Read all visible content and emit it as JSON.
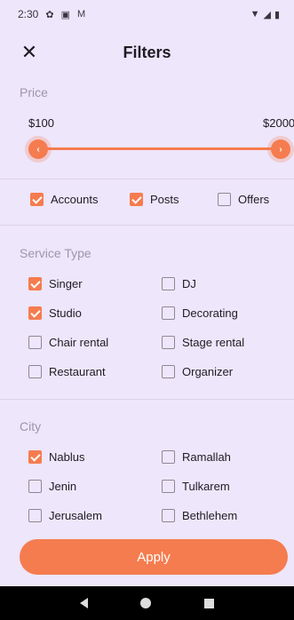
{
  "status_bar": {
    "time": "2:30",
    "icons": [
      "gear-icon",
      "notification-icon",
      "gmail-icon"
    ],
    "right_icons": [
      "wifi-icon",
      "signal-icon",
      "battery-icon"
    ]
  },
  "header": {
    "title": "Filters",
    "close_icon": "close-icon"
  },
  "price": {
    "label": "Price",
    "min_label": "$100",
    "max_label": "$2000",
    "range_min_fraction": 0.0,
    "range_max_fraction": 1.0
  },
  "types": [
    {
      "label": "Accounts",
      "checked": true
    },
    {
      "label": "Posts",
      "checked": true
    },
    {
      "label": "Offers",
      "checked": false
    }
  ],
  "service_type": {
    "label": "Service Type",
    "options": [
      {
        "label": "Singer",
        "checked": true
      },
      {
        "label": "DJ",
        "checked": false
      },
      {
        "label": "Studio",
        "checked": true
      },
      {
        "label": "Decorating",
        "checked": false
      },
      {
        "label": "Chair rental",
        "checked": false
      },
      {
        "label": "Stage rental",
        "checked": false
      },
      {
        "label": "Restaurant",
        "checked": false
      },
      {
        "label": "Organizer",
        "checked": false
      }
    ]
  },
  "city": {
    "label": "City",
    "options": [
      {
        "label": "Nablus",
        "checked": true
      },
      {
        "label": "Ramallah",
        "checked": false
      },
      {
        "label": "Jenin",
        "checked": false
      },
      {
        "label": "Tulkarem",
        "checked": false
      },
      {
        "label": "Jerusalem",
        "checked": false
      },
      {
        "label": "Bethlehem",
        "checked": false
      }
    ]
  },
  "apply_label": "Apply",
  "colors": {
    "accent": "#F57C4F",
    "background": "#EEE6FB",
    "nav_bar": "#000000"
  }
}
